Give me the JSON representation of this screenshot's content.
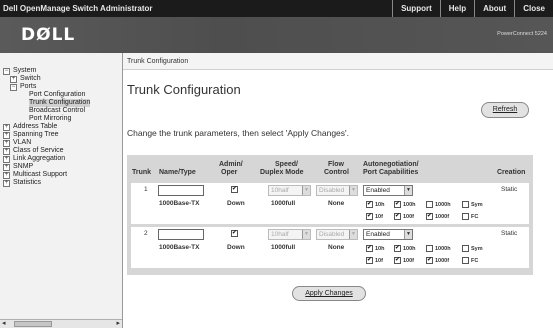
{
  "header": {
    "app_title": "Dell OpenManage Switch Administrator",
    "links": [
      "Support",
      "Help",
      "About",
      "Close"
    ],
    "logo_text": "DØLL",
    "model": "PowerConnect 5224"
  },
  "tree": {
    "items": [
      {
        "label": "System",
        "pm": "−"
      },
      {
        "label": "Switch",
        "pm": "+"
      },
      {
        "label": "Ports",
        "pm": "−"
      },
      {
        "label": "Port Configuration",
        "pm": ""
      },
      {
        "label": "Trunk Configuration",
        "pm": ""
      },
      {
        "label": "Broadcast Control",
        "pm": ""
      },
      {
        "label": "Port Mirroring",
        "pm": ""
      },
      {
        "label": "Address Table",
        "pm": "+"
      },
      {
        "label": "Spanning Tree",
        "pm": "+"
      },
      {
        "label": "VLAN",
        "pm": "+"
      },
      {
        "label": "Class of Service",
        "pm": "+"
      },
      {
        "label": "Link Aggregation",
        "pm": "+"
      },
      {
        "label": "SNMP",
        "pm": "+"
      },
      {
        "label": "Multicast Support",
        "pm": "+"
      },
      {
        "label": "Statistics",
        "pm": "+"
      }
    ]
  },
  "scrollbar": {
    "left": "◂",
    "right": "▸"
  },
  "breadcrumb": "Trunk Configuration",
  "page": {
    "title": "Trunk Configuration",
    "refresh": "Refresh",
    "instructions": "Change the trunk parameters, then select 'Apply Changes'."
  },
  "table": {
    "headers": {
      "trunk": "Trunk",
      "name": "Name/Type",
      "admin1": "Admin/",
      "admin2": "Oper",
      "speed1": "Speed/",
      "speed2": "Duplex Mode",
      "flow1": "Flow",
      "flow2": "Control",
      "auto1": "Autonegotiation/",
      "auto2": "Port Capabilities",
      "creation": "Creation"
    },
    "rows": [
      {
        "trunk": "1",
        "name_value": "",
        "type": "1000Base-TX",
        "admin_check": "✔",
        "oper": "Down",
        "speed_select": "10half",
        "speed_value": "1000full",
        "flow_select": "Disabled",
        "flow_value": "None",
        "autoneg_select": "Enabled",
        "caps": [
          {
            "label": "10h",
            "check": "✔"
          },
          {
            "label": "100h",
            "check": "✔"
          },
          {
            "label": "1000h",
            "check": ""
          },
          {
            "label": "Sym",
            "check": ""
          },
          {
            "label": "10f",
            "check": "✔"
          },
          {
            "label": "100f",
            "check": "✔"
          },
          {
            "label": "1000f",
            "check": "✔"
          },
          {
            "label": "FC",
            "check": ""
          }
        ],
        "creation": "Static"
      },
      {
        "trunk": "2",
        "name_value": "",
        "type": "1000Base-TX",
        "admin_check": "✔",
        "oper": "Down",
        "speed_select": "10half",
        "speed_value": "1000full",
        "flow_select": "Disabled",
        "flow_value": "None",
        "autoneg_select": "Enabled",
        "caps": [
          {
            "label": "10h",
            "check": "✔"
          },
          {
            "label": "100h",
            "check": "✔"
          },
          {
            "label": "1000h",
            "check": ""
          },
          {
            "label": "Sym",
            "check": ""
          },
          {
            "label": "10f",
            "check": "✔"
          },
          {
            "label": "100f",
            "check": "✔"
          },
          {
            "label": "1000f",
            "check": "✔"
          },
          {
            "label": "FC",
            "check": ""
          }
        ],
        "creation": "Static"
      }
    ]
  },
  "apply_button": "Apply Changes",
  "icons": {
    "check": "check-icon",
    "dropdown": "chevron-down-icon",
    "expand": "plus-icon",
    "collapse": "minus-icon"
  }
}
